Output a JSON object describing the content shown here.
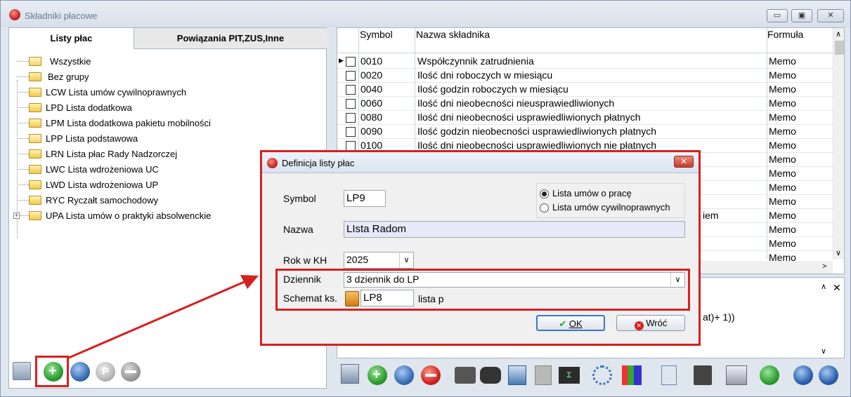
{
  "window": {
    "title": "Składniki płacowe"
  },
  "tabs": [
    {
      "label": "Listy płac"
    },
    {
      "label": "Powiązania PIT,ZUS,Inne"
    }
  ],
  "tree": [
    {
      "label": "Wszystkie",
      "open": true
    },
    {
      "label": "Bez grupy"
    },
    {
      "label": "LCW Lista umów cywilnoprawnych"
    },
    {
      "label": "LPD Lista dodatkowa"
    },
    {
      "label": "LPM Lista dodatkowa pakietu mobilności"
    },
    {
      "label": "LPP Lista podstawowa",
      "open": true
    },
    {
      "label": "LRN Lista płac Rady Nadzorczej"
    },
    {
      "label": "LWC Lista wdrożeniowa UC"
    },
    {
      "label": "LWD Lista wdrożeniowa UP"
    },
    {
      "label": "RYC Ryczałt samochodowy"
    },
    {
      "label": "UPA Lista umów o praktyki absolwenckie",
      "expandable": true
    }
  ],
  "grid": {
    "columns": {
      "symbol": "Symbol",
      "name": "Nazwa składnika",
      "formula": "Formuła"
    },
    "rows": [
      {
        "symbol": "0010",
        "name": "Współczynnik zatrudnienia",
        "formula": "Memo"
      },
      {
        "symbol": "0020",
        "name": "Ilość dni roboczych w miesiącu",
        "formula": "Memo"
      },
      {
        "symbol": "0040",
        "name": "Ilość godzin roboczych w miesiącu",
        "formula": "Memo"
      },
      {
        "symbol": "0060",
        "name": "Ilość dni nieobecności nieusprawiedliwionych",
        "formula": "Memo"
      },
      {
        "symbol": "0080",
        "name": "Ilość dni nieobecności usprawiedliwionych płatnych",
        "formula": "Memo"
      },
      {
        "symbol": "0090",
        "name": "Ilość godzin nieobecności usprawiedliwionych płatnych",
        "formula": "Memo"
      },
      {
        "symbol": "0100",
        "name": "Ilość dni nieobecności usprawiedliwionych nie płatnych",
        "formula": "Memo"
      },
      {
        "symbol": "",
        "name": "",
        "formula": "Memo"
      },
      {
        "symbol": "",
        "name": "",
        "formula": "Memo"
      },
      {
        "symbol": "",
        "name": "",
        "formula": "Memo"
      },
      {
        "symbol": "",
        "name": "",
        "formula": "Memo"
      },
      {
        "symbol": "",
        "name": "iem",
        "formula": "Memo"
      },
      {
        "symbol": "",
        "name": "",
        "formula": "Memo"
      },
      {
        "symbol": "",
        "name": "",
        "formula": "Memo"
      },
      {
        "symbol": "",
        "name": "",
        "formula": "Memo"
      }
    ]
  },
  "lower": {
    "formula_text": "at)+ 1))"
  },
  "dialog": {
    "title": "Definicja listy płac",
    "symbol_label": "Symbol",
    "symbol_value": "LP9",
    "radio1": "Lista umów o pracę",
    "radio2": "Lista umów cywilnoprawnych",
    "nazwa_label": "Nazwa",
    "nazwa_value": "LIsta Radom",
    "rok_label": "Rok w KH",
    "rok_value": "2025",
    "dziennik_label": "Dziennik",
    "dziennik_value": "3  dziennik do LP",
    "schemat_label": "Schemat ks.",
    "schemat_value": "LP8",
    "schemat_desc": "lista p",
    "ok_label": "OK",
    "cancel_label": "Wróć"
  },
  "colors": {
    "highlight": "#d62020",
    "titlebar": "#d7dfe9",
    "nazwa_bg": "#e8e8f8"
  }
}
